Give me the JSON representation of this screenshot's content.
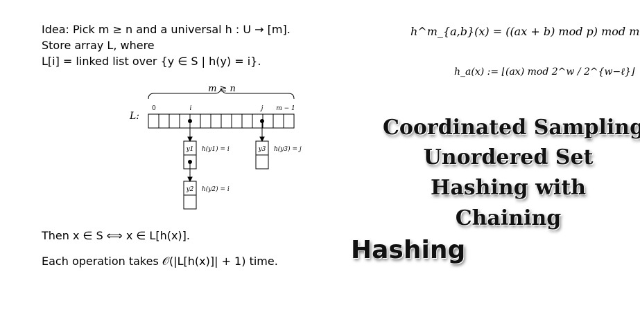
{
  "slide": {
    "idea_line": "Idea: Pick m ≥ n and a universal h : U → [m].",
    "store_line": "Store array L, where",
    "def_line": "L[i] = linked list over {y ∈ S | h(y) = i}.",
    "then_line": "Then x ∈ S ⟺ x ∈ L[h(x)].",
    "op_line": "Each operation takes 𝒪(|L[h(x)]| + 1) time.",
    "formula_mod": "h^m_{a,b}(x) = ((ax + b) mod p) mod m",
    "formula_mult": "h_a(x) := ⌊(ax) mod 2^w / 2^{w−ℓ}⌋"
  },
  "diagram": {
    "brace_label": "m ≥ n",
    "array_label": "L:",
    "index_labels": [
      "0",
      "i",
      "j",
      "m − 1"
    ],
    "array_cells": 14,
    "chains": [
      {
        "index": "i",
        "nodes": [
          {
            "key": "y1",
            "hash": "h(y1) = i"
          },
          {
            "key": "y2",
            "hash": "h(y2) = i"
          }
        ]
      },
      {
        "index": "j",
        "nodes": [
          {
            "key": "y3",
            "hash": "h(y3) = j"
          }
        ]
      }
    ]
  },
  "titles": {
    "topics": [
      "Coordinated Sampling",
      "Unordered Set",
      "Hashing with",
      "Chaining"
    ],
    "main": "Hashing"
  }
}
